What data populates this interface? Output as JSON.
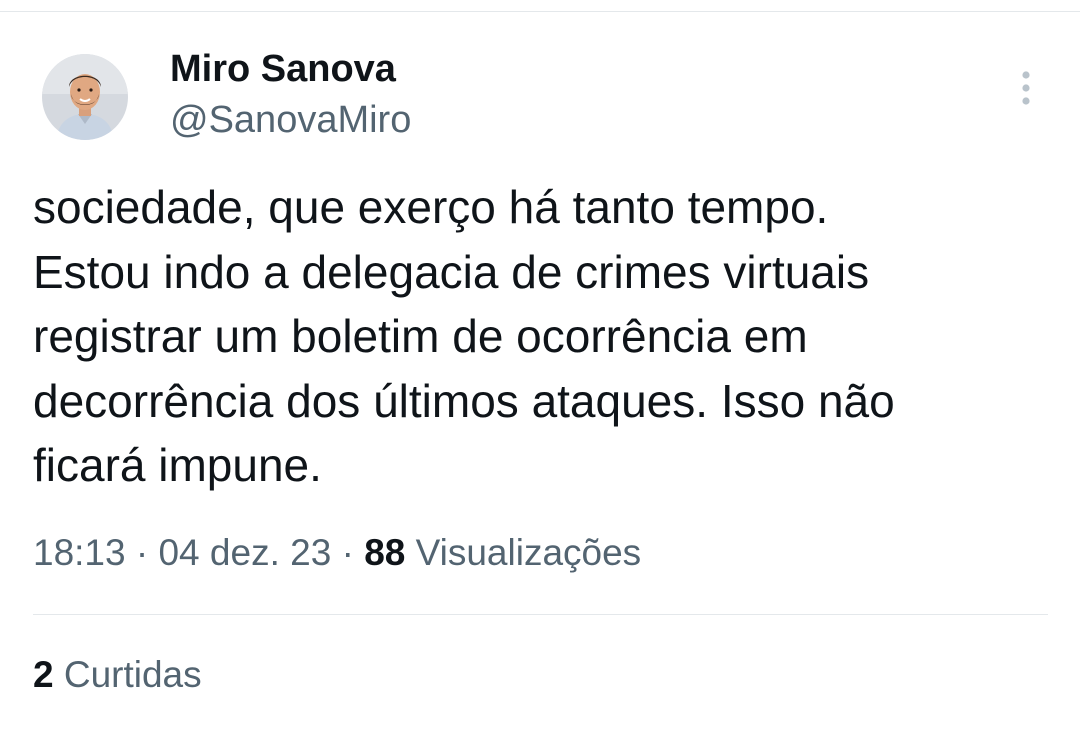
{
  "user": {
    "display_name": "Miro Sanova",
    "handle": "@SanovaMiro"
  },
  "tweet": {
    "lines": [
      "sociedade, que exerço há tanto tempo.",
      "Estou indo a delegacia de crimes virtuais",
      "registrar um boletim de ocorrência em",
      "decorrência dos últimos ataques. Isso não",
      "ficará impune."
    ],
    "time": "18:13",
    "separator": "·",
    "date": "04 dez. 23",
    "views_count": "88",
    "views_label": "Visualizações",
    "likes_count": "2",
    "likes_label": "Curtidas"
  },
  "icons": {
    "more": "more-vertical-icon",
    "avatar": "profile-photo"
  },
  "colors": {
    "text_primary": "#0f1419",
    "text_secondary": "#536471",
    "divider": "#e4e8eb",
    "more_icon": "#b9c3cb"
  }
}
